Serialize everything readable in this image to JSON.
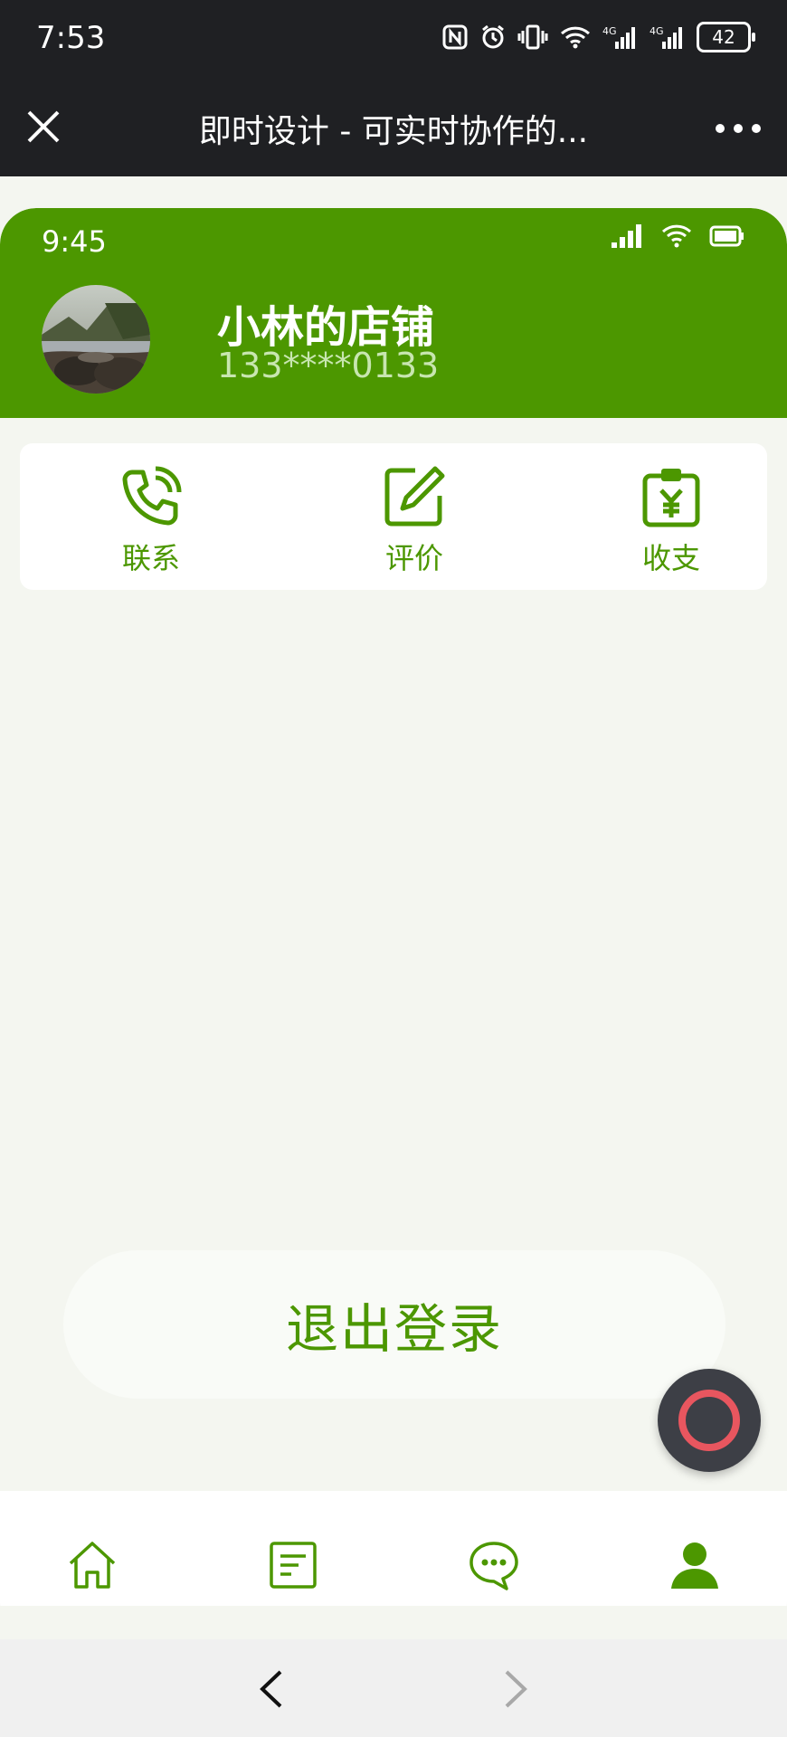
{
  "system_status": {
    "time": "7:53",
    "battery": "42"
  },
  "wechat": {
    "title": "即时设计 - 可实时协作的..."
  },
  "app": {
    "status_time": "9:45",
    "profile": {
      "shop_name": "小林的店铺",
      "phone": "133****0133"
    },
    "actions": [
      {
        "label": "联系",
        "icon": "phone-icon"
      },
      {
        "label": "评价",
        "icon": "edit-icon"
      },
      {
        "label": "收支",
        "icon": "yen-clipboard-icon"
      }
    ],
    "logout_label": "退出登录",
    "tabs": [
      {
        "icon": "home-icon"
      },
      {
        "icon": "document-icon"
      },
      {
        "icon": "chat-icon"
      },
      {
        "icon": "user-icon"
      }
    ]
  },
  "colors": {
    "brand_green": "#4c9700",
    "background": "#f4f6f0",
    "float_ring": "#e8565f"
  }
}
